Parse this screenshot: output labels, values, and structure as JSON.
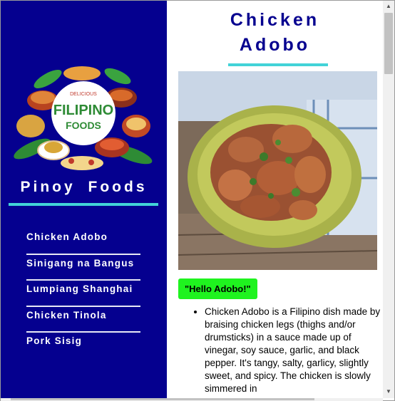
{
  "sidebar": {
    "logo": {
      "top_text": "DELICIOUS",
      "main_text": "FILIPINO",
      "bottom_text": "FOODS"
    },
    "brand": "Pinoy  Foods",
    "nav": [
      {
        "label": "Chicken Adobo"
      },
      {
        "label": "Sinigang na Bangus"
      },
      {
        "label": "Lumpiang Shanghai"
      },
      {
        "label": "Chicken Tinola"
      },
      {
        "label": "Pork Sisig"
      }
    ]
  },
  "main": {
    "title_line1": "Chicken",
    "title_line2": "Adobo",
    "button_label": "\"Hello Adobo!\"",
    "description": "Chicken Adobo is a Filipino dish made by braising chicken legs (thighs and/or drumsticks) in a sauce made up of vinegar, soy sauce, garlic, and black pepper. It's tangy, salty, garlicy, slightly sweet, and spicy. The chicken is slowly simmered in"
  },
  "colors": {
    "sidebar_bg": "#05008f",
    "accent_line": "#42d3d8",
    "button_bg": "#1ff31f"
  },
  "icons": {
    "scroll_up": "triangle-up-icon",
    "scroll_down": "triangle-down-icon"
  }
}
